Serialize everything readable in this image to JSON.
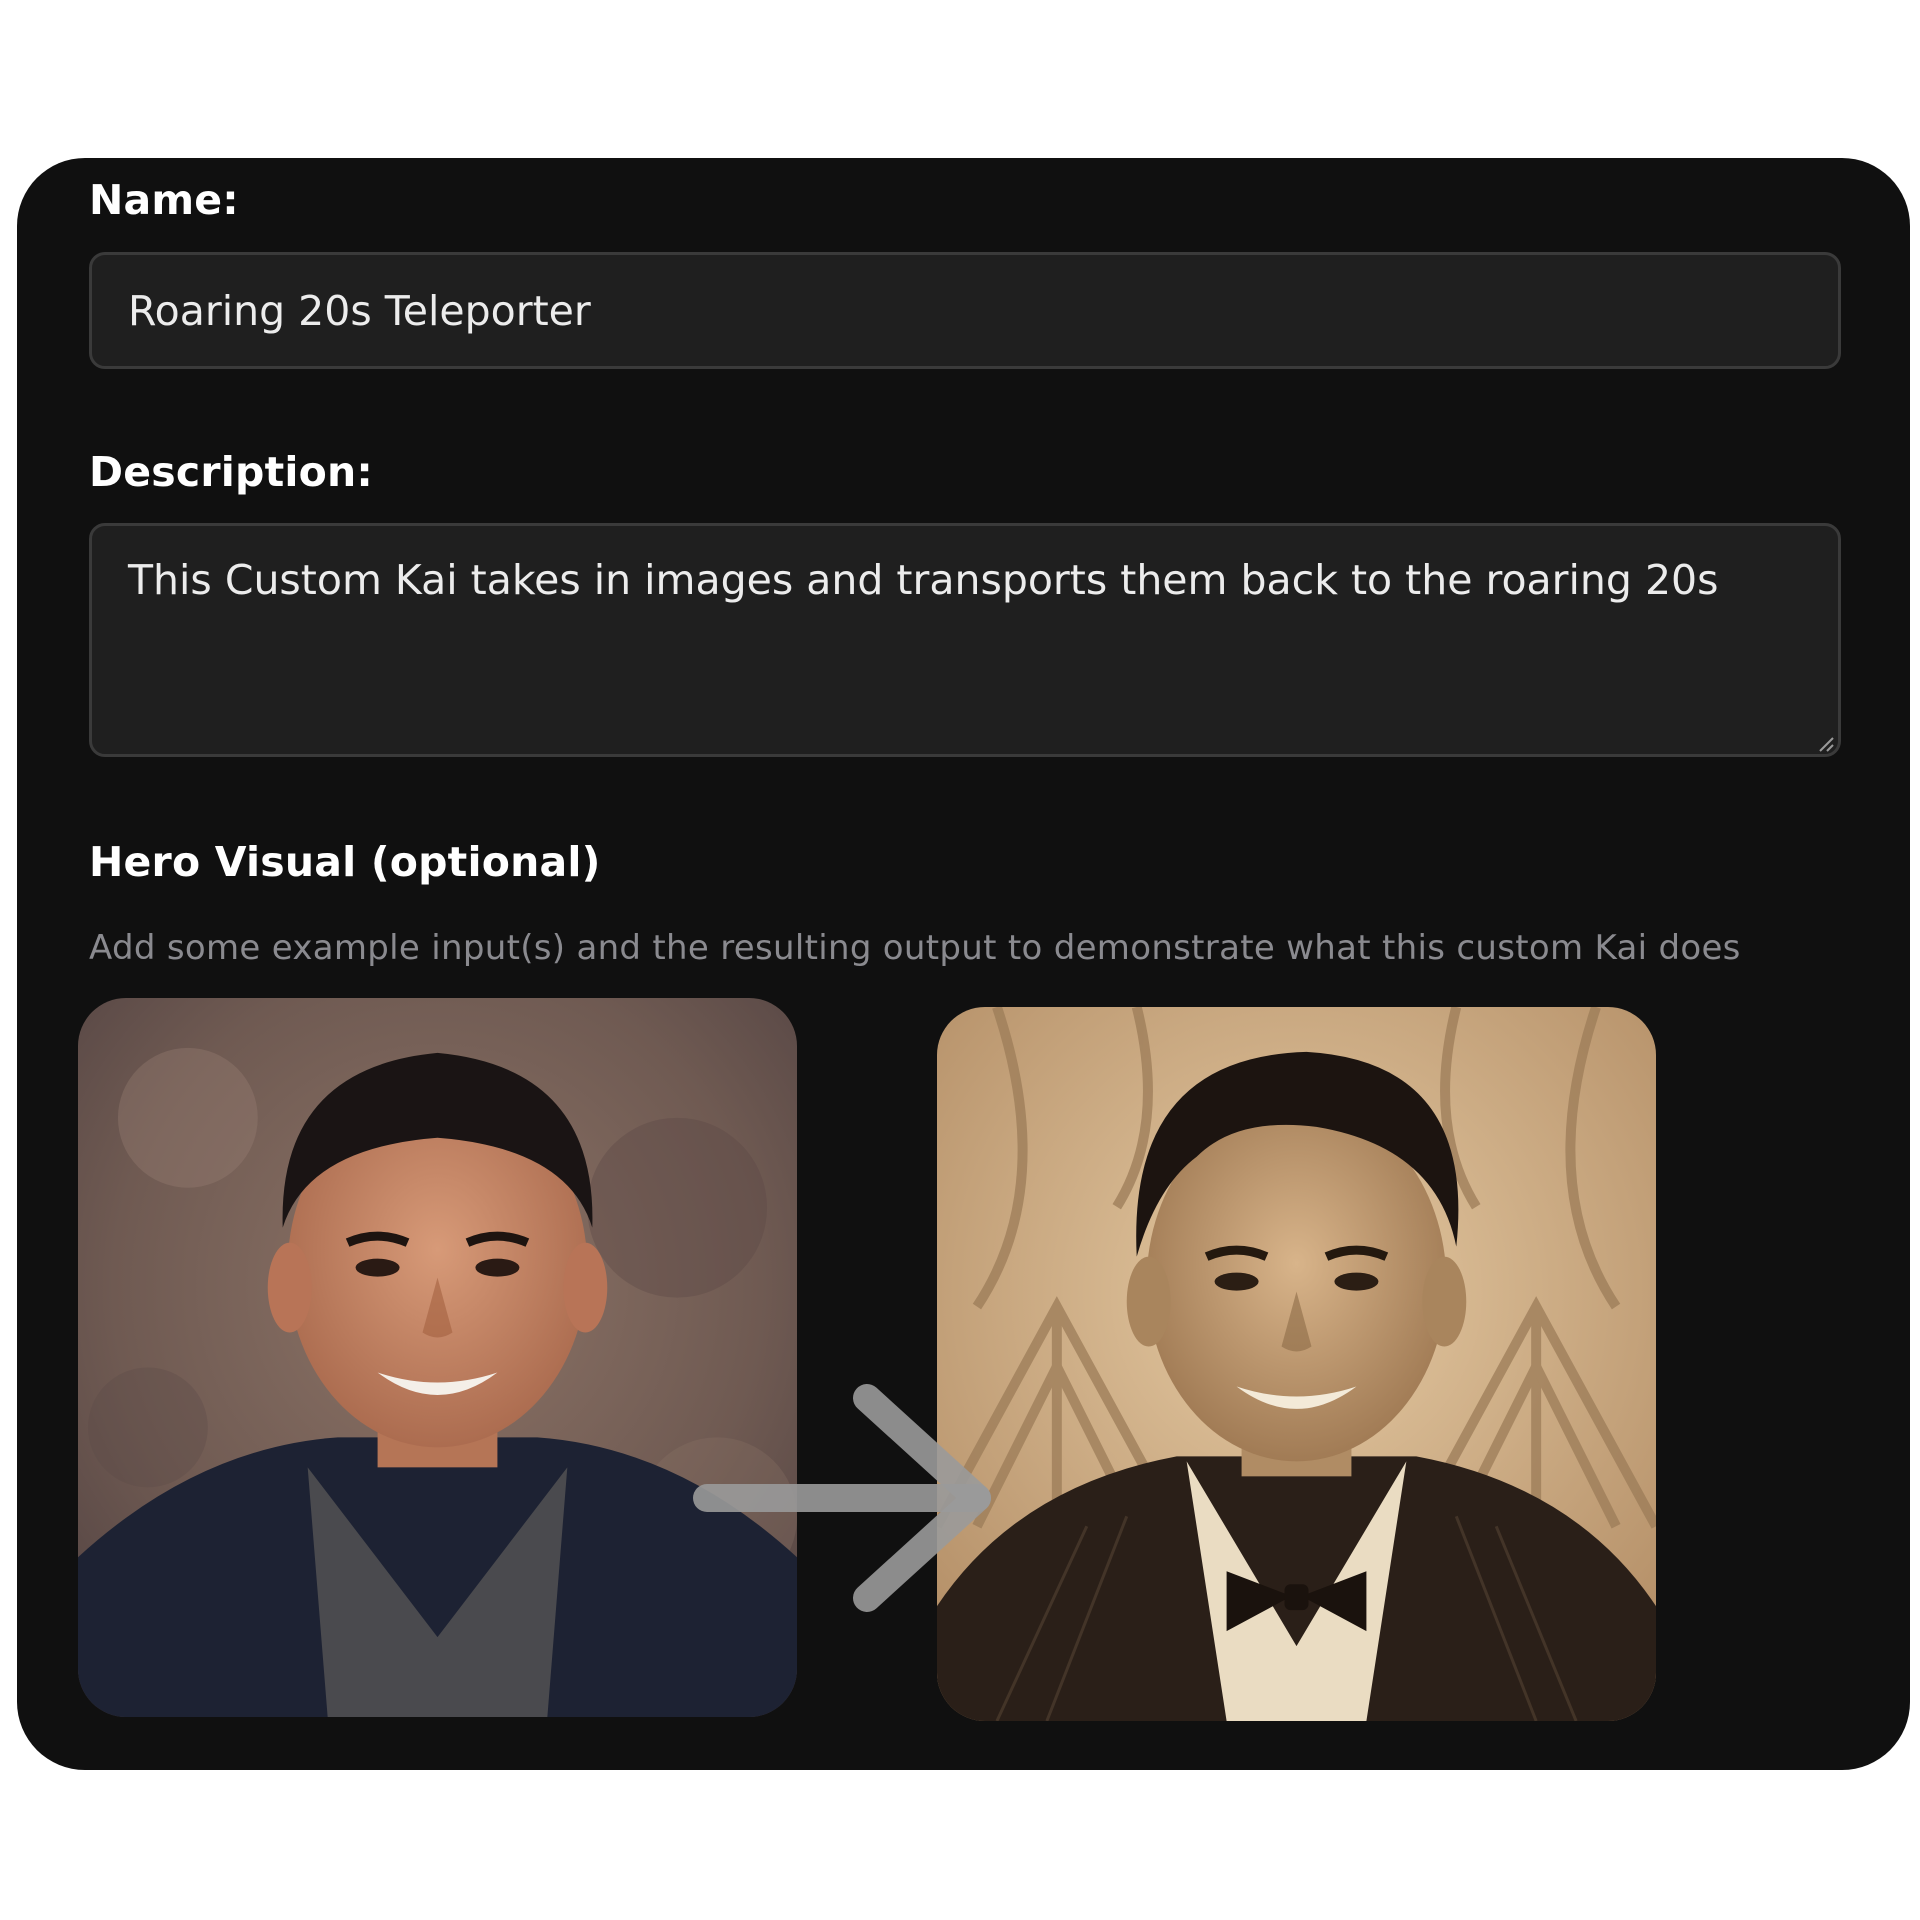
{
  "form": {
    "name_label": "Name:",
    "name_value": "Roaring 20s Teleporter",
    "description_label": "Description:",
    "description_value": "This Custom Kai takes in images and transports them back to the roaring 20s",
    "hero_label": "Hero Visual (optional)",
    "hero_helper": "Add some example input(s) and the resulting output to demonstrate what this custom Kai does"
  },
  "colors": {
    "card_background": "#101010",
    "field_background": "#1f1f1f",
    "field_border": "#3a3a3a",
    "helper_text": "#8a8a8f",
    "arrow": "#9a9a9a",
    "sepia": "#c9a57a"
  },
  "icons": {
    "transform_arrow": "right-arrow-icon",
    "resize_handle": "resize-grip-icon"
  },
  "images": {
    "input_photo": "portrait-input-photo",
    "output_photo": "portrait-1920s-sepia-output"
  }
}
